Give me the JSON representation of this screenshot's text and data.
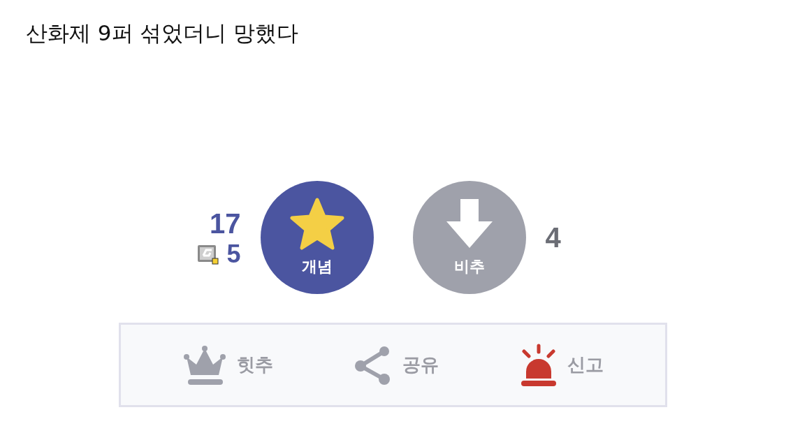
{
  "title": "산화제 9퍼 섞었더니 망했다",
  "upvote": {
    "count": "17",
    "fixed_count": "5",
    "label": "개념"
  },
  "downvote": {
    "count": "4",
    "label": "비추"
  },
  "actions": [
    {
      "kind": "best",
      "label": "힛추"
    },
    {
      "kind": "share",
      "label": "공유"
    },
    {
      "kind": "report",
      "label": "신고"
    }
  ]
}
